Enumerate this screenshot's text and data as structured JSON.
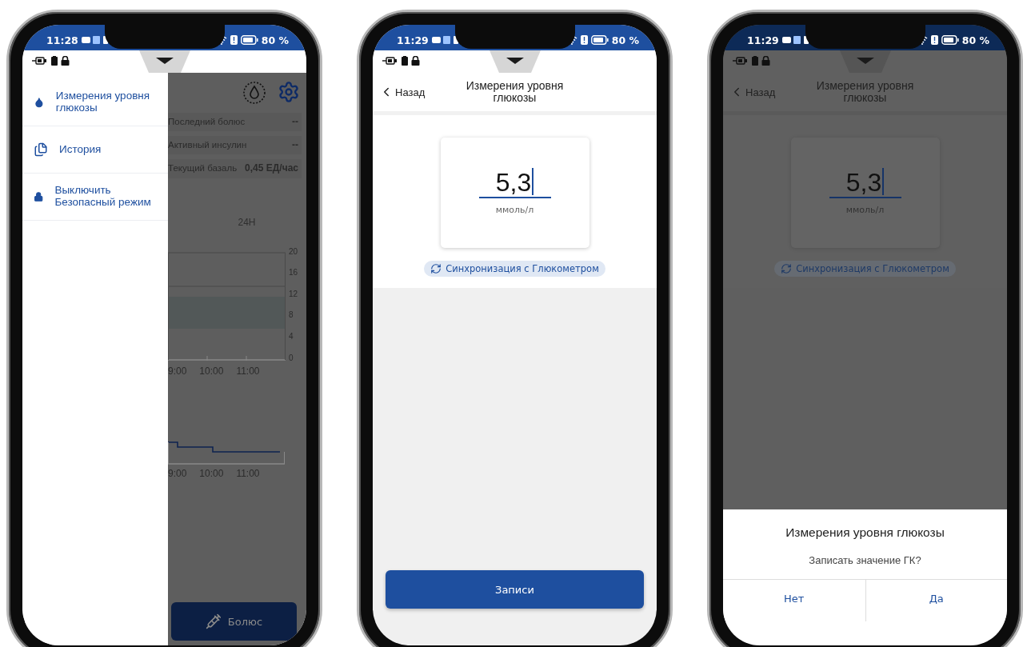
{
  "phones": [
    {
      "kind": "menu",
      "dimmed": true,
      "status_bar": {
        "time": "11:28",
        "battery": "80 %"
      },
      "drawer": {
        "items": [
          {
            "kind": "drop",
            "label": "Измерения уровня глюкозы"
          },
          {
            "kind": "document",
            "label": "История"
          },
          {
            "kind": "lock",
            "label": "Выключить Безопасный режим"
          }
        ]
      },
      "dashboard": {
        "info_rows": [
          {
            "label": "Последний болюс",
            "value": "--"
          },
          {
            "label": "Активный инсулин",
            "value": "--"
          },
          {
            "label": "Текущий базаль",
            "value": "0,45 ЕД/час"
          }
        ],
        "period_tabs": [
          "24H"
        ],
        "glucose_chart": {
          "y_ticks": [
            "20",
            "16",
            "12",
            "8",
            "4",
            "0"
          ],
          "x_ticks": [
            "9:00",
            "10:00",
            "11:00"
          ]
        },
        "basal_chart": {
          "x_ticks": [
            "9:00",
            "10:00",
            "11:00"
          ]
        },
        "bolus_button": "Болюс"
      }
    },
    {
      "kind": "entry",
      "dimmed": false,
      "status_bar": {
        "time": "11:29",
        "battery": "80 %"
      },
      "header": {
        "back": "Назад",
        "title": "Измерения уровня глюкозы"
      },
      "reading": {
        "value": "5,3",
        "unit": "ммоль/л"
      },
      "sync_chip": "Синхронизация с Глюкометром",
      "primary_button": "Записи"
    },
    {
      "kind": "confirm",
      "dimmed": true,
      "status_bar": {
        "time": "11:29",
        "battery": "80 %"
      },
      "header": {
        "back": "Назад",
        "title": "Измерения уровня глюкозы"
      },
      "reading": {
        "value": "5,3",
        "unit": "ммоль/л"
      },
      "sync_chip": "Синхронизация с Глюкометром",
      "dialog": {
        "title": "Измерения уровня глюкозы",
        "message": "Записать значение ГК?",
        "buttons": [
          "Нет",
          "Да"
        ]
      }
    }
  ]
}
